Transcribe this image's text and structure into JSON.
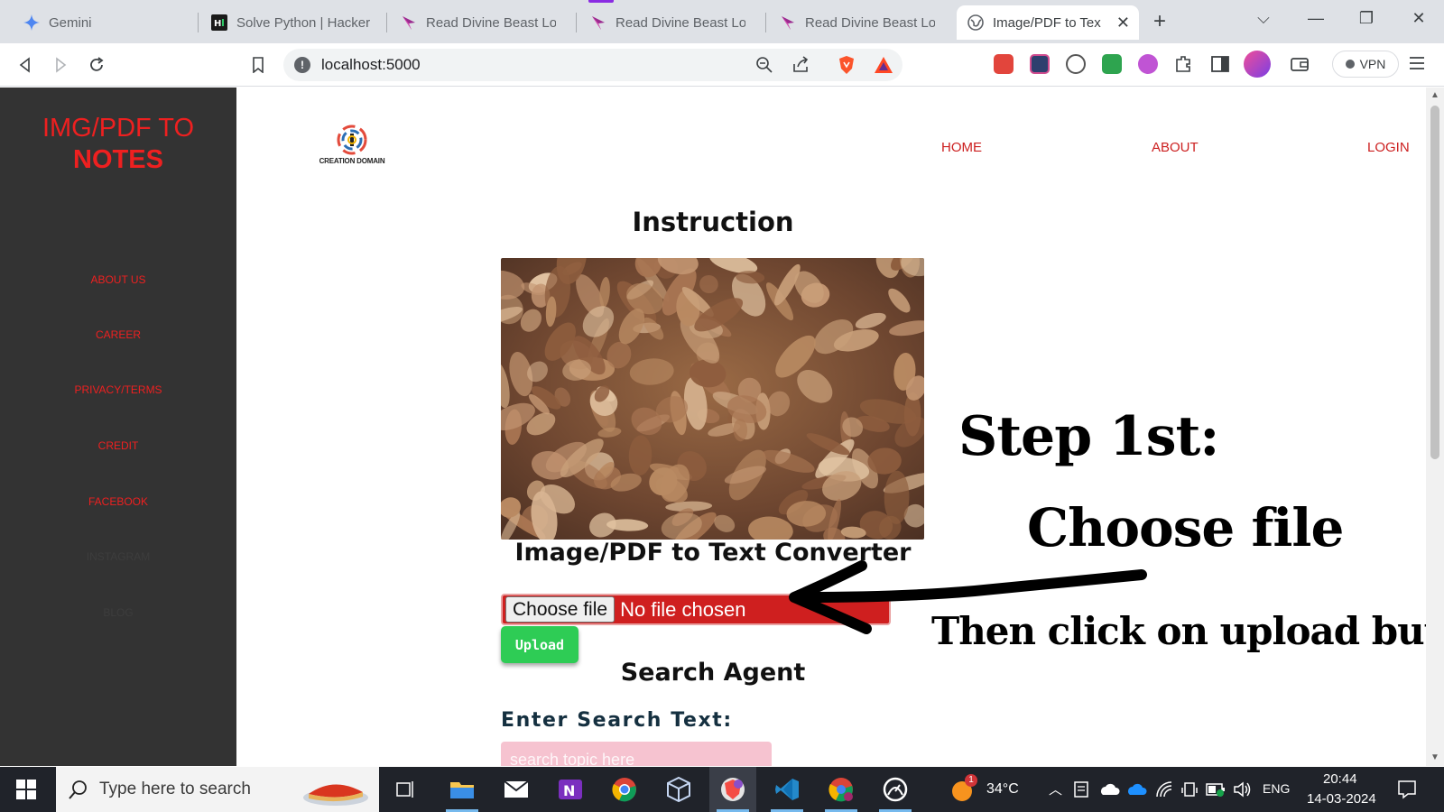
{
  "browser": {
    "tabs": [
      {
        "title": "Gemini",
        "icon": "gemini-sparkle-icon"
      },
      {
        "title": "Solve Python | HackerR",
        "icon": "hackerrank-icon"
      },
      {
        "title": "Read Divine Beast Lord",
        "icon": "book-site-icon"
      },
      {
        "title": "Read Divine Beast Lord",
        "icon": "book-site-icon"
      },
      {
        "title": "Read Divine Beast Lord",
        "icon": "book-site-icon"
      },
      {
        "title": "Image/PDF to Tex",
        "icon": "globe-icon",
        "active": true
      }
    ],
    "url": "localhost:5000",
    "vpn_label": "VPN"
  },
  "site": {
    "brand_line1": "IMG/PDF TO",
    "brand_line2": "NOTES",
    "sidebar_links": [
      "ABOUT US",
      "CAREER",
      "PRIVACY/TERMS",
      "CREDIT",
      "FACEBOOK",
      "INSTAGRAM",
      "BLOG"
    ],
    "logo_caption": "CREATION DOMAIN",
    "nav": {
      "home": "HOME",
      "about": "ABOUT",
      "login": "LOGIN"
    },
    "instruction_heading": "Instruction",
    "converter_heading": "Image/PDF to Text Converter",
    "file_button_label": "Choose file",
    "file_status": "No file chosen",
    "upload_label": "Upload",
    "search_heading": "Search Agent",
    "search_label": "Enter Search Text:",
    "search_placeholder": "search topic here",
    "annotation_step": "Step 1st:",
    "annotation_choose": "Choose file",
    "annotation_upload": "Then click on upload button"
  },
  "taskbar": {
    "search_placeholder": "Type here to search",
    "weather": "34°C",
    "language": "ENG",
    "time": "20:44",
    "date": "14-03-2024",
    "notification_badge": "1"
  },
  "colors": {
    "sidebar_bg": "#333333",
    "brand_red": "#ee2020",
    "nav_red": "#cc1f1f",
    "upload_green": "#2ecc55",
    "file_input_red": "#cf1f1f",
    "search_input_pink": "#f6c3d0"
  }
}
